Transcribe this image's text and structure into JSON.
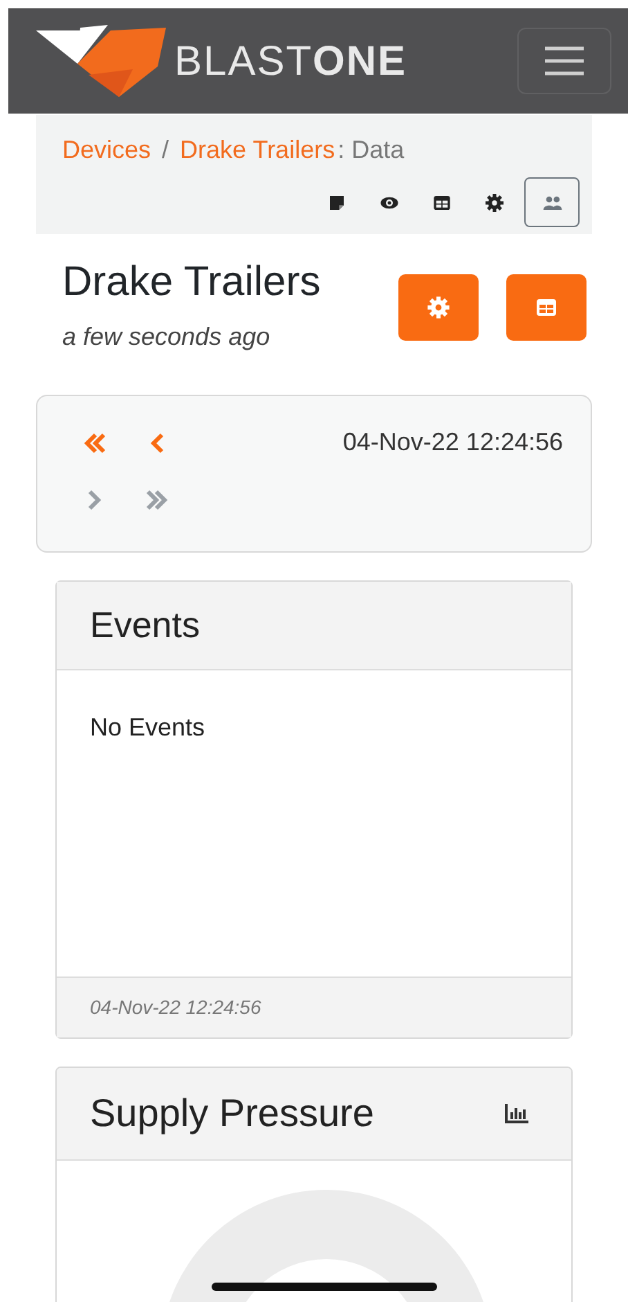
{
  "navbar": {
    "brand_light": "BLAST",
    "brand_bold": "ONE"
  },
  "breadcrumb": {
    "items": [
      {
        "label": "Devices",
        "kind": "link"
      },
      {
        "label": "/",
        "kind": "separator"
      },
      {
        "label": "Drake Trailers",
        "kind": "link"
      },
      {
        "label": ": Data",
        "kind": "current"
      }
    ],
    "toolbar": [
      {
        "kind": "note",
        "selected": false
      },
      {
        "kind": "eye",
        "selected": false
      },
      {
        "kind": "table",
        "selected": false
      },
      {
        "kind": "gear",
        "selected": false
      },
      {
        "kind": "users",
        "selected": true
      }
    ]
  },
  "header": {
    "title": "Drake Trailers",
    "subtitle": "a few seconds ago",
    "buttons": [
      {
        "kind": "gear"
      },
      {
        "kind": "table"
      }
    ]
  },
  "navigator": {
    "timestamp": "04-Nov-22 12:24:56",
    "buttons": [
      {
        "kind": "first",
        "disabled": false
      },
      {
        "kind": "prev",
        "disabled": false
      },
      {
        "kind": "next",
        "disabled": true
      },
      {
        "kind": "last",
        "disabled": true
      }
    ]
  },
  "events_card": {
    "title": "Events",
    "body": "No Events",
    "footer": "04-Nov-22 12:24:56"
  },
  "pressure_card": {
    "title": "Supply Pressure"
  }
}
